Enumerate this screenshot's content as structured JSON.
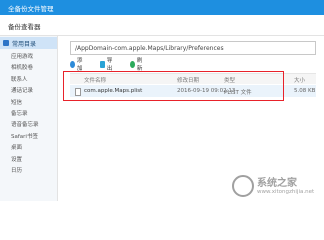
{
  "window": {
    "title": "全备份文件管理"
  },
  "header": {
    "title": "备份查看器"
  },
  "sidebar": {
    "section_label": "常用目录",
    "items": [
      {
        "label": "应用游戏"
      },
      {
        "label": "相机胶卷"
      },
      {
        "label": "联系人"
      },
      {
        "label": "通话记录"
      },
      {
        "label": "短信"
      },
      {
        "label": "备忘录"
      },
      {
        "label": "语音备忘录"
      },
      {
        "label": "Safari书签"
      },
      {
        "label": "桌面"
      },
      {
        "label": "设置"
      },
      {
        "label": "日历"
      }
    ]
  },
  "path": {
    "value": "/AppDomain-com.apple.Maps/Library/Preferences"
  },
  "toolbar": {
    "add_label": "添加",
    "export_label": "导出",
    "refresh_label": "刷新"
  },
  "table": {
    "columns": {
      "name": "文件名称",
      "date": "修改日期",
      "type": "类型",
      "size": "大小"
    },
    "rows": [
      {
        "name": "com.apple.Maps.plist",
        "date": "2016-09-19 09:02:13",
        "type": "PLIST 文件",
        "size": "5.08 KB"
      }
    ]
  },
  "watermark": {
    "text": "系统之家",
    "url": "www.xitongzhijia.net"
  }
}
